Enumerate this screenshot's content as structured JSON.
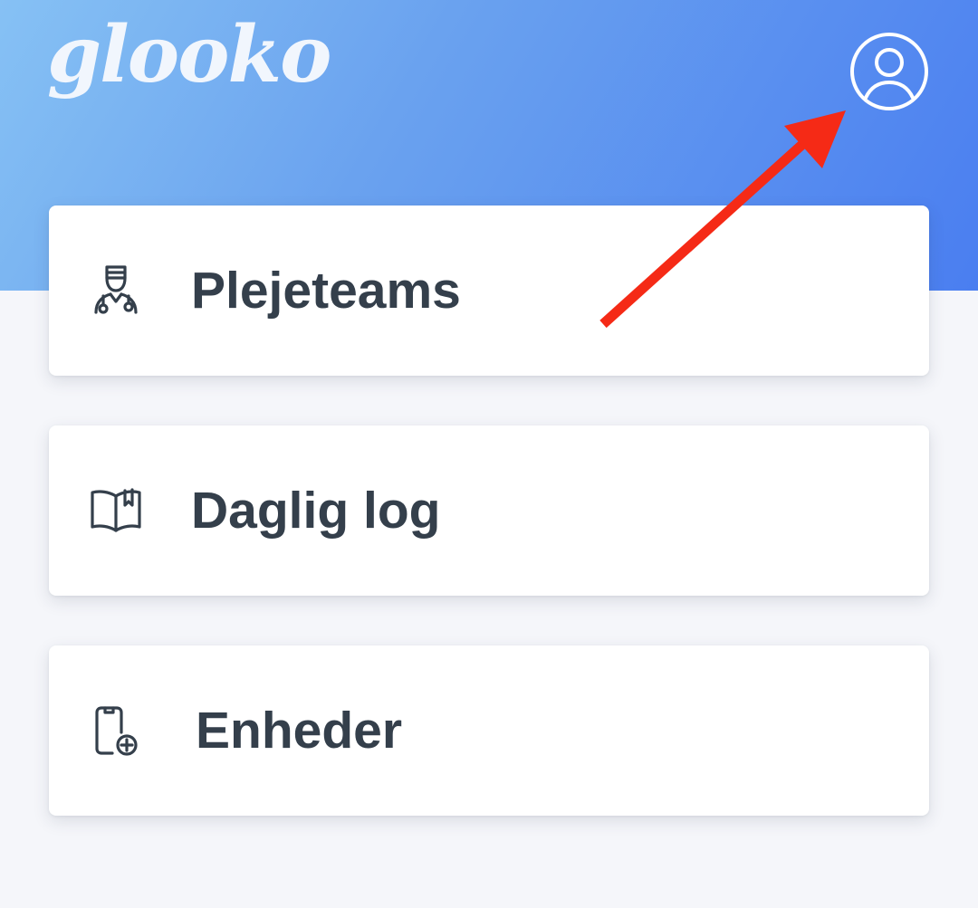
{
  "header": {
    "logo_text": "glooko",
    "profile_icon": "user-circle-icon"
  },
  "menu": [
    {
      "label": "Plejeteams",
      "icon": "care-team-icon"
    },
    {
      "label": "Daglig log",
      "icon": "book-icon"
    },
    {
      "label": "Enheder",
      "icon": "device-add-icon"
    }
  ],
  "annotation": {
    "arrow_color": "#f52a16"
  },
  "colors": {
    "header_gradient_start": "#86c1f4",
    "header_gradient_end": "#4a7ef0",
    "page_background": "#f5f6fa",
    "card_background": "#ffffff",
    "text": "#343f4b"
  }
}
